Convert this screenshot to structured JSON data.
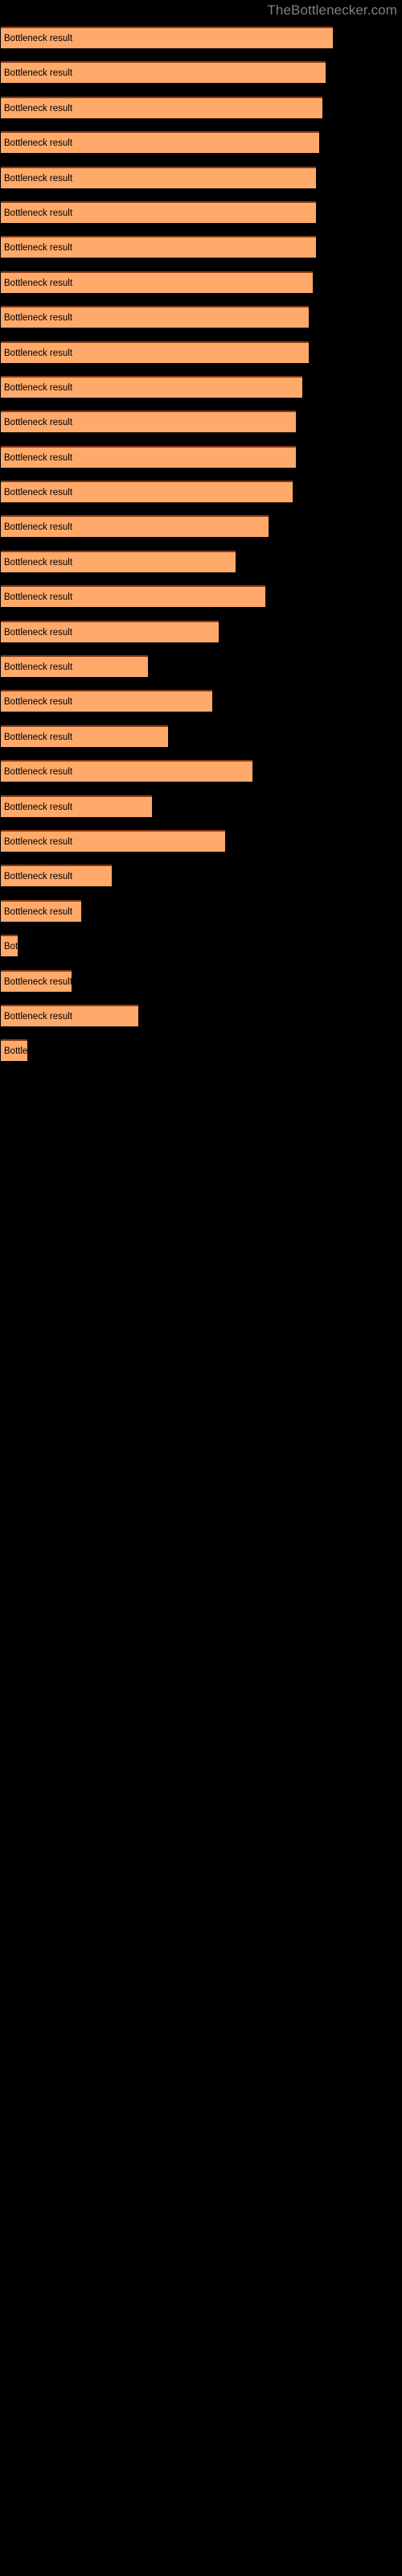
{
  "watermark": {
    "text": "TheBottlenecker.com",
    "color": "#808080"
  },
  "colors": {
    "background": "#000000",
    "bar_fill": "#ffa96b",
    "bar_border_top": "#8a3a12",
    "label_text": "#000000"
  },
  "chart_data": {
    "type": "bar",
    "orientation": "horizontal",
    "title": "",
    "subtitle": "",
    "xlabel": "",
    "ylabel": "",
    "grid": false,
    "legend": null,
    "xlim": [
      0,
      120
    ],
    "bar_label": "Bottleneck result",
    "categories": [
      "Bottleneck result",
      "Bottleneck result",
      "Bottleneck result",
      "Bottleneck result",
      "Bottleneck result",
      "Bottleneck result",
      "Bottleneck result",
      "Bottleneck result",
      "Bottleneck result",
      "Bottleneck result",
      "Bottleneck result",
      "Bottleneck result",
      "Bottleneck result",
      "Bottleneck result",
      "Bottleneck result",
      "Bottleneck result",
      "Bottleneck result",
      "Bottleneck result",
      "Bottleneck result",
      "Bottleneck result",
      "Bottleneck result",
      "Bottleneck result",
      "Bottleneck result",
      "Bottleneck result",
      "Bottleneck result",
      "Bottleneck result",
      "Bottleneck result",
      "Bottleneck result",
      "Bottleneck result",
      "Bottleneck result"
    ],
    "values": [
      99,
      97,
      96,
      95,
      94,
      94,
      94,
      93,
      92,
      92,
      90,
      88,
      88,
      87,
      80,
      70,
      79,
      65,
      44,
      63,
      50,
      75,
      45,
      67,
      33,
      24,
      5,
      21,
      41,
      8
    ]
  }
}
